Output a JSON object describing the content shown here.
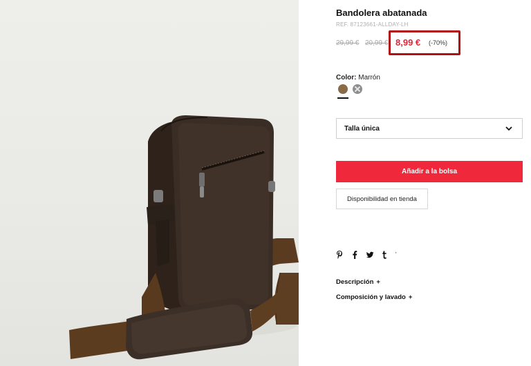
{
  "product": {
    "title": "Bandolera abatanada",
    "ref": "REF. 87123661-ALLDAY-LH",
    "old_price_1": "29,99 €",
    "old_price_2": "20,99 €",
    "sale_price": "8,99 €",
    "discount": "(-70%)",
    "sale_price_color": "#e32636"
  },
  "color": {
    "label": "Color:",
    "value": "Marrón",
    "swatches": [
      {
        "name": "brown",
        "hex": "#8a6a47",
        "selected": true,
        "available": true
      },
      {
        "name": "grey",
        "hex": "#8e8e8e",
        "selected": false,
        "available": false
      }
    ]
  },
  "size": {
    "selected": "Talla única",
    "icon": "chevron-down-icon"
  },
  "actions": {
    "add_to_bag": "Añadir a la bolsa",
    "add_to_bag_color": "#f0283b",
    "store_availability": "Disponibilidad en tienda"
  },
  "share": {
    "icons": [
      "pinterest-icon",
      "facebook-icon",
      "twitter-icon",
      "tumblr-icon",
      "more-icon"
    ],
    "more_glyph": "'"
  },
  "accordion": {
    "description": "Descripción",
    "composition": "Composición y lavado",
    "expand_glyph": "+"
  }
}
